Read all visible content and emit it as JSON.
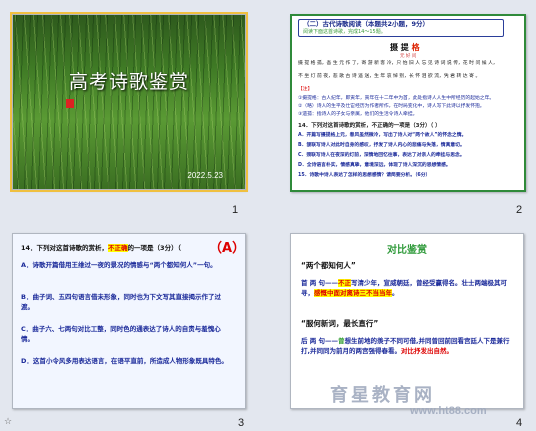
{
  "slides": [
    {
      "number": "1",
      "title": "高考诗歌鉴赏",
      "date": "2022.5.23"
    },
    {
      "number": "2",
      "header": "（二）古代诗歌阅读（本题共2小题，9分）",
      "header_sub": "阅读下面这首诗歌，完成14～15题。",
      "poem_title_plain": "摄 提 ",
      "poem_title_red": "格",
      "author": "元 好 问",
      "poem_lines": [
        "摄 提 格 孤，吾 生 元 作 了，寄 游 新 客 冷，只 怕 旧 人 忘 见 诗 词 说 传，花 时 问 候 人，",
        "不 坐 灯 前 夜，悲 歌 古 诗 遥 送，生 年 哀 悼 别，长 怀 泪 欲 流，凭 君 转 达 寄 。",
        "【注】"
      ],
      "notes": [
        "①摄提格：古人纪年，即寅年，寅年在十二年中为首，此处指诗人人生中所经历的起始之年。",
        "②（略）诗人的生平及仕宦经历为作者所作，在时局变化中，诗人写下此诗以抒发怀抱。",
        "③遗孤：指诗人的子女与亲属，他们的生活令诗人牵挂。"
      ],
      "question_14": "14．下列对这首诗歌的赏析，不正确的一项是（3分）（  ）",
      "options": [
        "A．开篇写摄提格上元，春风虽然微冷，写出了诗人对“两个故人”的怀念之情。",
        "B．颔联写诗人对此时自身的感叹，抒发了诗人内心的悲痛与失落，情真意切。",
        "C．颈联写诗人在夜深的灯前，深情地回忆往事，表达了对亲人的牵挂与思念。",
        "D．全诗语言朴实，情感真挚，意境深远，体现了诗人深沉的思想情感。"
      ],
      "question_15": "15．诗歌中诗人表达了怎样的思想感情？请简要分析。（6分）"
    },
    {
      "number": "3",
      "question_prefix": "14．下列对这首诗歌的赏析，",
      "question_highlight": "不正确",
      "question_suffix": "的一项是（3分）（",
      "question_end": "）",
      "answer": "A",
      "options": [
        "A．诗歌开篇借用王维过一夜的景况的情感与“两个都知何人”一句。",
        "B．曲子词、五四句语言借未形象，同时也为下文写其直接揭示作了过渡。",
        "C．曲子六、七两句对比工整，同时色的通表达了诗人的自责与羞愧心情。",
        "D．这首小令风多用表达语言，在语平直前，所造成人物形象既具特色。"
      ]
    },
    {
      "number": "4",
      "heading": "对比鉴赏",
      "sub1": "“两个都知何人”",
      "para1_pre": "首 两 句——",
      "para1_hl": "不正",
      "para1_mid": "写清少年，宣威朝廷，曾经受赢得名。壮士两端极其可寻，",
      "para1_hl2": "感慨中面对离诗三不当当年",
      "para1_end": "。",
      "sub2": "“服何新词，最长直行”",
      "para2_pre": "后 两 句——",
      "para2_g": "曾",
      "para2_mid": "想生前地的羡子不同可借,并同曾回前回看宫廷人下是兼行打,并同同为前月的两宫强得春看。",
      "para2_r": "对比抒发出自然。",
      "watermark": "育星教育网",
      "watermark_url": "www.ht88.com"
    }
  ],
  "footer_icon": "star-icon"
}
